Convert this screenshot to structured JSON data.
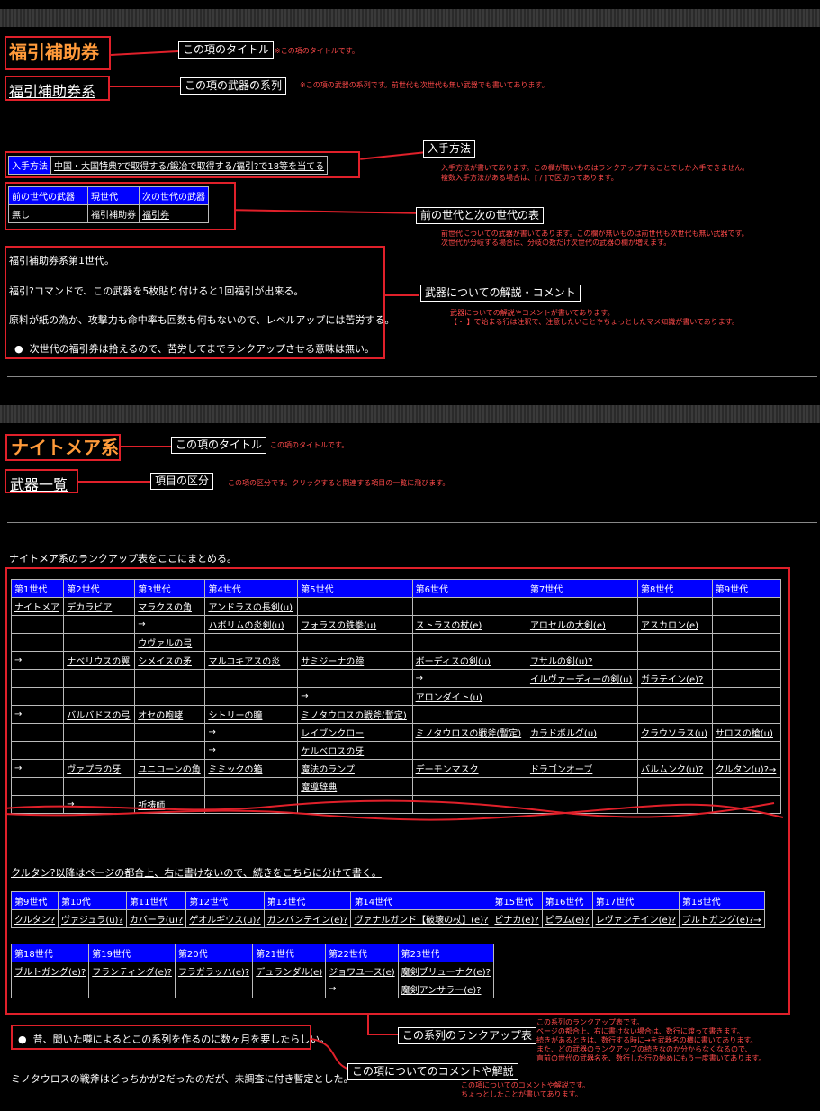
{
  "section1": {
    "title": "福引補助券",
    "series": "福引補助券系",
    "label_title": "この項のタイトル",
    "note_title": "※この項のタイトルです。",
    "label_series": "この項の武器の系列",
    "note_series": "※この項の武器の系列です。前世代も次世代も無い武器でも書いてあります。",
    "acq_header": "入手方法",
    "acq_text": "中国・大国特典?で取得する/鍛冶で取得する/福引?で18等を当てる",
    "label_acq": "入手方法",
    "note_acq1": "入手方法が書いてあります。この欄が無いものはランクアップすることでしか入手できません。",
    "note_acq2": "複数入手方法がある場合は、[ / ]で区切ってあります。",
    "gen_headers": [
      "前の世代の武器",
      "現世代",
      "次の世代の武器"
    ],
    "gen_values": [
      "無し",
      "福引補助券",
      "福引券"
    ],
    "label_gen": "前の世代と次の世代の表",
    "note_gen1": "前世代についての武器が書いてあります。この欄が無いものは前世代も次世代も無い武器です。",
    "note_gen2": "次世代が分岐する場合は、分岐の数だけ次世代の武器の欄が増えます。",
    "desc1": "福引補助券系第1世代。",
    "desc2": "福引?コマンドで、この武器を5枚貼り付けると1回福引が出来る。",
    "desc3": "原料が紙の為か、攻撃力も命中率も回数も何もないので、レベルアップには苦労する。",
    "desc4": "次世代の福引券は拾えるので、苦労してまでランクアップさせる意味は無い。",
    "label_desc": "武器についての解説・コメント",
    "note_desc1": "武器についての解説やコメントが書いてあります。",
    "note_desc2": "【・ 】で始まる行は注釈で、注意したいことやちょっとしたマメ知識が書いてあります。"
  },
  "section2": {
    "title": "ナイトメア系",
    "label_title": "この項のタイトル",
    "note_title": "この項のタイトルです。",
    "category": "武器一覧",
    "label_category": "項目の区分",
    "note_category": "この項の区分です。クリックすると関連する項目の一覧に飛びます。",
    "intro": "ナイトメア系のランクアップ表をここにまとめる。",
    "rank_headers": [
      "第1世代",
      "第2世代",
      "第3世代",
      "第4世代",
      "第5世代",
      "第6世代",
      "第7世代",
      "第8世代",
      "第9世代"
    ],
    "rank_rows": [
      [
        "ナイトメア",
        "デカラビア",
        "マラクスの角",
        "アンドラスの長剣(u)",
        "",
        "",
        "",
        "",
        ""
      ],
      [
        "",
        "",
        "→",
        "ハボリムの炎剣(u)",
        "フォラスの鉄拳(u)",
        "ストラスの杖(e)",
        "アロセルの大剣(e)",
        "アスカロン(e)",
        ""
      ],
      [
        "",
        "",
        "ウヴァルの弓",
        "",
        "",
        "",
        "",
        "",
        ""
      ],
      [
        "→",
        "ナベリウスの翼",
        "シメイスの矛",
        "マルコキアスの炎",
        "サミジーナの蹄",
        "ボーディスの剣(u)",
        "フサルの剣(u)?",
        "",
        ""
      ],
      [
        "",
        "",
        "",
        "",
        "",
        "→",
        "イルヴァーディーの剣(u)",
        "ガラテイン(e)?",
        ""
      ],
      [
        "",
        "",
        "",
        "",
        "→",
        "アロンダイト(u)",
        "",
        "",
        ""
      ],
      [
        "→",
        "バルバドスの弓",
        "オセの咆哮",
        "シトリーの瞳",
        "ミノタウロスの戦斧(暫定)",
        "",
        "",
        "",
        ""
      ],
      [
        "",
        "",
        "",
        "→",
        "レイブンクロー",
        "ミノタウロスの戦斧(暫定)",
        "カラドボルグ(u)",
        "クラウソラス(u)",
        "サロスの槍(u)"
      ],
      [
        "",
        "",
        "",
        "→",
        "ケルベロスの牙",
        "",
        "",
        "",
        ""
      ],
      [
        "→",
        "ヴァプラの牙",
        "ユニコーンの角",
        "ミミックの箱",
        "魔法のランプ",
        "デーモンマスク",
        "ドラゴンオーブ",
        "バルムンク(u)?",
        "クルタン(u)?→"
      ],
      [
        "",
        "",
        "",
        "",
        "魔導辞典",
        "",
        "",
        "",
        ""
      ],
      [
        "",
        "→",
        "祈祷師",
        "",
        "",
        "",
        "",
        "",
        ""
      ]
    ],
    "cont_text": "クルタン?以降はページの都合上、右に書けないので、続きをこちらに分けて書く。",
    "rank2_headers": [
      "第9世代",
      "第10代",
      "第11世代",
      "第12世代",
      "第13世代",
      "第14世代",
      "第15世代",
      "第16世代",
      "第17世代",
      "第18世代"
    ],
    "rank2_values": [
      "クルタン?",
      "ヴァジュラ(u)?",
      "カバーラ(u)?",
      "ゲオルギウス(u)?",
      "ガンバンテイン(e)?",
      "ヴァナルガンド【破壊の杖】(e)?",
      "ピナカ(e)?",
      "ピラム(e)?",
      "レヴァンテイン(e)?",
      "ブルトガング(e)?→"
    ],
    "rank3_headers": [
      "第18世代",
      "第19世代",
      "第20代",
      "第21世代",
      "第22世代",
      "第23世代"
    ],
    "rank3_row1": [
      "ブルトガング(e)?",
      "フランティング(e)?",
      "フラガラッハ(e)?",
      "デュランダル(e)",
      "ジョワユース(e)",
      "魔剣ブリューナク(e)?"
    ],
    "rank3_row2": [
      "",
      "",
      "",
      "",
      "→",
      "魔剣アンサラー(e)?"
    ],
    "label_rank": "この系列のランクアップ表",
    "note_rank": [
      "この系列のランクアップ表です。",
      "ページの都合上、右に書けない場合は、数行に渡って書きます。",
      "続きがあるときは、数行する時に→を武器名の横に書いてあります。",
      "また、どの武器のランクアップの続きなのか分からなくなるので、",
      "直前の世代の武器名を、数行した行の始めにもう一度書いてあります。"
    ],
    "comment_bullet": "昔、聞いた噂によるとこの系列を作るのに数ヶ月を要したらしい。",
    "comment_text": "ミノタウロスの戦斧はどっちかが2だったのだが、未調査に付き暫定とした。",
    "label_comment": "この項についてのコメントや解説",
    "note_comment1": "この項についてのコメントや解説です。",
    "note_comment2": "ちょっとしたことが書いてあります。"
  }
}
